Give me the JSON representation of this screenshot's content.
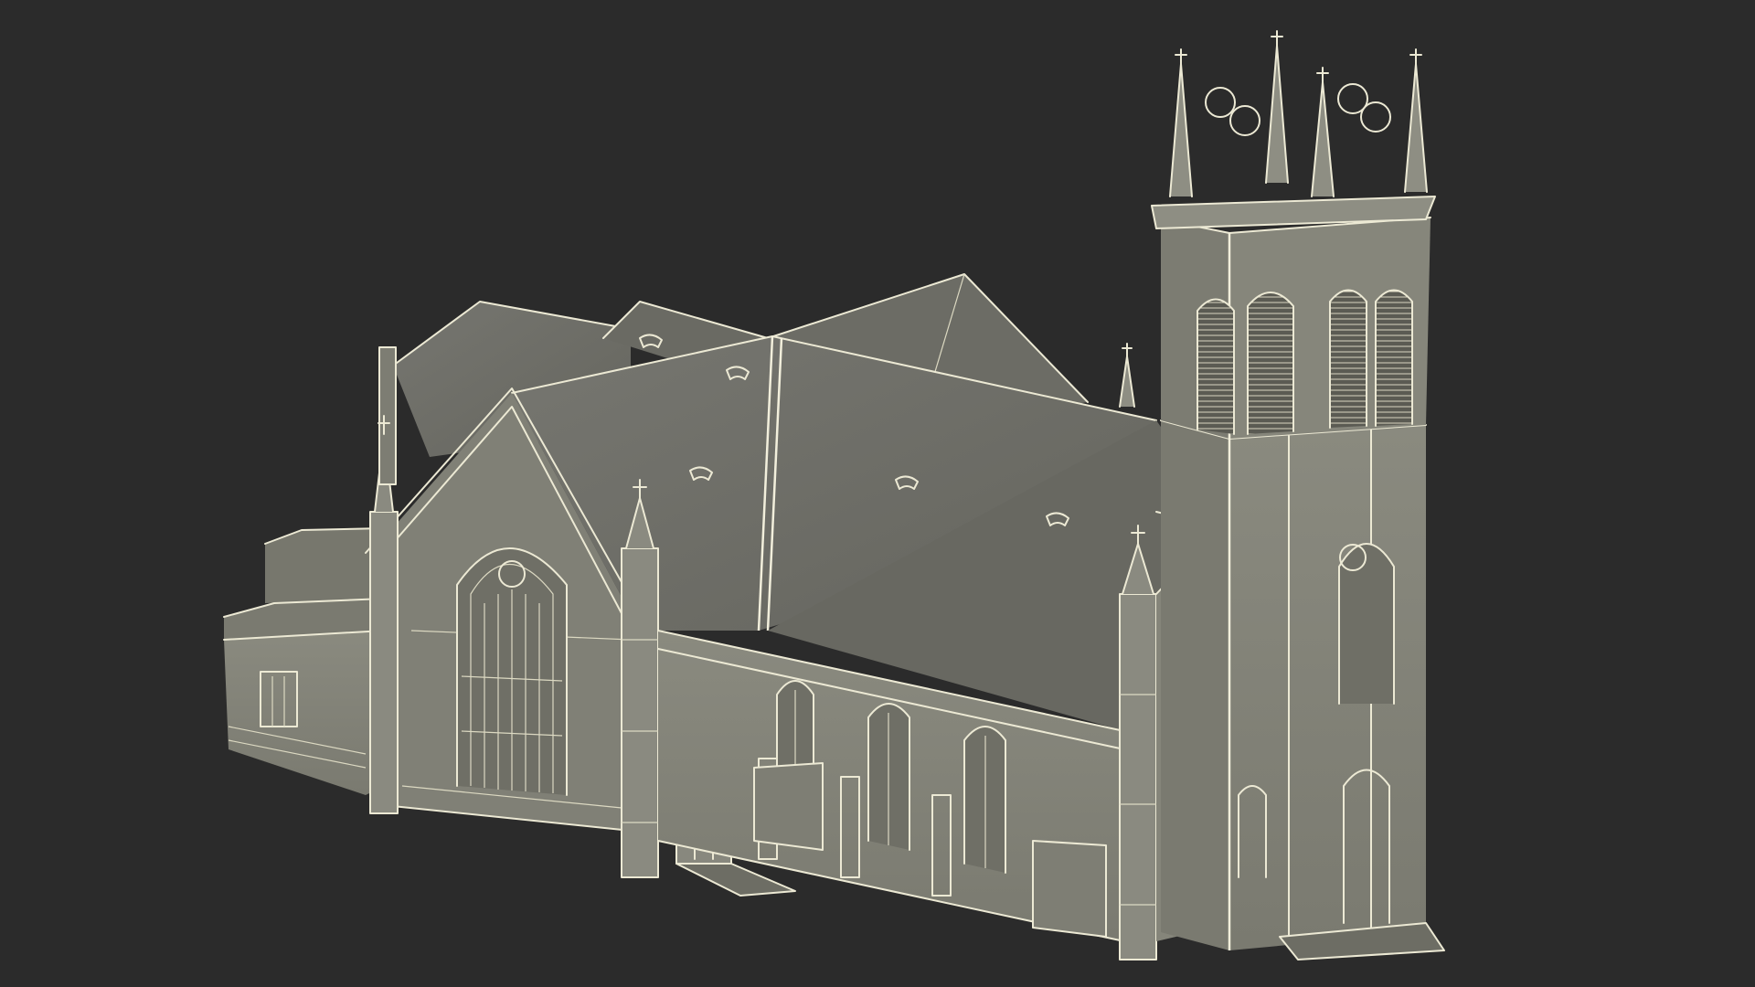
{
  "scene": {
    "background": "#2b2b2b",
    "model": "gothic-church",
    "render_style": "grey clay with white wireframe overlay",
    "colors": {
      "roof": "#6f6f69",
      "roof_dark": "#626259",
      "wall": "#848479",
      "wall_light": "#8d8d82",
      "wall_dark": "#6c6c63",
      "wire": "#ece9d4"
    }
  }
}
